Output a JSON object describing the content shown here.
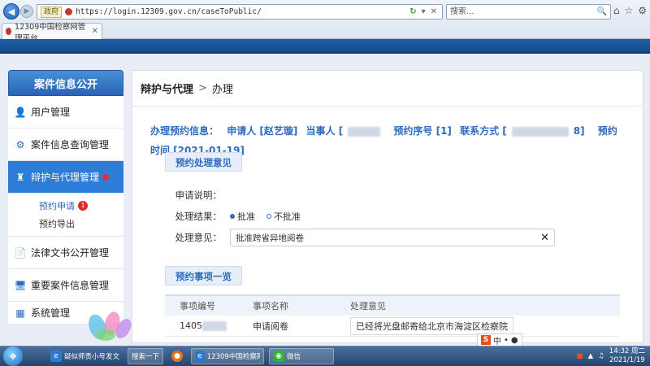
{
  "browser": {
    "cert_label": "政府",
    "url": "https://login.12309.gov.cn/caseToPublic/",
    "search_placeholder": "搜索...",
    "tab_title": "12309中国检察网管理平台"
  },
  "sidebar": {
    "title": "案件信息公开",
    "items": [
      {
        "label": "用户管理",
        "icon": "user-icon"
      },
      {
        "label": "案件信息查询管理",
        "icon": "case-query-icon"
      },
      {
        "label": "辩护与代理管理",
        "icon": "defense-icon",
        "active": true
      },
      {
        "label": "法律文书公开管理",
        "icon": "document-icon"
      },
      {
        "label": "重要案件信息管理",
        "icon": "monitor-icon"
      },
      {
        "label": "系统管理",
        "icon": "system-icon"
      }
    ],
    "sub_items": [
      {
        "label": "预约申请",
        "badge": "1"
      },
      {
        "label": "预约导出"
      }
    ]
  },
  "main": {
    "breadcrumb": {
      "parent": "辩护与代理",
      "current": "办理",
      "separator": ">"
    },
    "info": {
      "label": "办理预约信息：",
      "applicant": "申请人 [赵艺璇]",
      "party_prefix": "当事人 [",
      "order_no": "预约序号 [1]",
      "contact_prefix": "联系方式 [",
      "contact_suffix": "8]",
      "time": "预约时间 [2021-01-19]"
    },
    "process_section": "预约处理意见",
    "form": {
      "desc_label": "申请说明：",
      "result_label": "处理结果：",
      "approve": "批准",
      "reject": "不批准",
      "opinion_label": "处理意见：",
      "opinion_value": "批准跨省异地阅卷"
    },
    "items_section": "预约事项一览",
    "table": {
      "headers": [
        "事项编号",
        "事项名称",
        "处理意见"
      ],
      "rows": [
        {
          "id": "1405",
          "name": "申请阅卷",
          "opinion": "已经将光盘邮寄给北京市海淀区检察院"
        }
      ]
    }
  },
  "ime": {
    "label": "中"
  },
  "taskbar": {
    "items": [
      {
        "label": "疑似师责小号发文",
        "icon": "ie-icon"
      },
      {
        "label": "搜索一下",
        "icon": ""
      },
      {
        "label": "",
        "icon": "firefox-icon"
      },
      {
        "label": "12309中国检察网...",
        "icon": "ie-icon"
      },
      {
        "label": "微信",
        "icon": "wechat-icon"
      }
    ],
    "time": "14:32 周二",
    "date": "2021/1/19"
  },
  "colors": {
    "accent": "#2d6cc0",
    "banner": "#1f5fa8",
    "active": "#2d7cd6",
    "badge": "#d92b2b"
  }
}
